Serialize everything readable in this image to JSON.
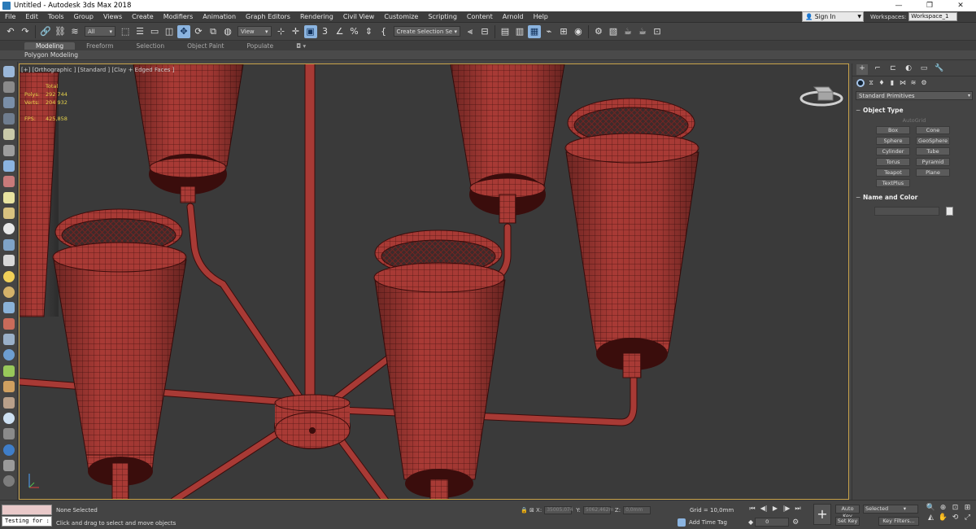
{
  "window": {
    "title": "Untitled - Autodesk 3ds Max 2018",
    "controls": [
      "—",
      "❐",
      "✕"
    ]
  },
  "menu": [
    "File",
    "Edit",
    "Tools",
    "Group",
    "Views",
    "Create",
    "Modifiers",
    "Animation",
    "Graph Editors",
    "Rendering",
    "Civil View",
    "Customize",
    "Scripting",
    "Content",
    "Arnold",
    "Help"
  ],
  "account": {
    "signin": "Sign In",
    "workspaces_label": "Workspaces:",
    "workspace": "Workspace_1"
  },
  "toolbar": {
    "filter": "All",
    "ref_coord": "View",
    "selection_set": "Create Selection Se"
  },
  "ribbon": {
    "tabs": [
      "Modeling",
      "Freeform",
      "Selection",
      "Object Paint",
      "Populate"
    ],
    "active_tab": "Modeling",
    "panel_label": "Polygon Modeling"
  },
  "viewport": {
    "label": "[+] [Orthographic ] [Standard ] [Clay + Edged Faces ]",
    "stats": {
      "header": "Total",
      "polys_label": "Polys:",
      "polys": "292 744",
      "verts_label": "Verts:",
      "verts": "204 932",
      "fps_label": "FPS:",
      "fps": "425,858"
    },
    "colors": {
      "background": "#3a3a3a",
      "mesh": "#a83a35",
      "wire": "#3a0d0c",
      "border": "#c9a44a"
    }
  },
  "command_panel": {
    "category": "Standard Primitives",
    "object_type_title": "Object Type",
    "autogrid": "AutoGrid",
    "buttons": [
      "Box",
      "Cone",
      "Sphere",
      "GeoSphere",
      "Cylinder",
      "Tube",
      "Torus",
      "Pyramid",
      "Teapot",
      "Plane",
      "TextPlus"
    ],
    "name_color_title": "Name and Color"
  },
  "status": {
    "script_text": "Testing for :",
    "selection": "None Selected",
    "prompt": "Click and drag to select and move objects",
    "x_label": "X:",
    "x": "35005,074",
    "y_label": "Y:",
    "y": "5062,462m",
    "z_label": "Z:",
    "z": "0,0mm",
    "grid": "Grid = 10,0mm",
    "add_time_tag": "Add Time Tag",
    "frame": "0",
    "auto_key": "Auto Key",
    "set_key": "Set Key",
    "key_mode": "Selected",
    "key_filters": "Key Filters..."
  }
}
